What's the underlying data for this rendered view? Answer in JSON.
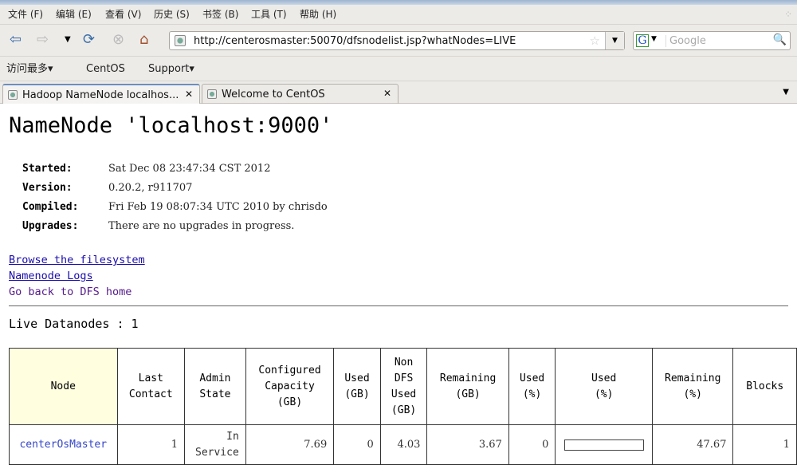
{
  "menu": [
    "文件 (F)",
    "编辑 (E)",
    "查看 (V)",
    "历史 (S)",
    "书签 (B)",
    "工具 (T)",
    "帮助 (H)"
  ],
  "url": "http://centerosmaster:50070/dfsnodelist.jsp?whatNodes=LIVE",
  "search_placeholder": "Google",
  "bookmarks": [
    "访问最多▾",
    "CentOS",
    "Support▾"
  ],
  "tabs": [
    {
      "label": "Hadoop NameNode localhos..."
    },
    {
      "label": "Welcome to CentOS"
    }
  ],
  "page": {
    "title": "NameNode 'localhost:9000'",
    "info": [
      {
        "k": "Started:",
        "v": "Sat Dec 08 23:47:34 CST 2012"
      },
      {
        "k": "Version:",
        "v": "0.20.2, r911707"
      },
      {
        "k": "Compiled:",
        "v": "Fri Feb 19 08:07:34 UTC 2010 by chrisdo"
      },
      {
        "k": "Upgrades:",
        "v": "There are no upgrades in progress."
      }
    ],
    "links": [
      "Browse the filesystem",
      "Namenode Logs",
      "Go back to DFS home"
    ],
    "live_heading": "Live Datanodes : 1"
  },
  "table": {
    "headers": [
      "Node",
      "Last\nContact",
      "Admin\nState",
      "Configured\nCapacity\n(GB)",
      "Used\n(GB)",
      "Non\nDFS\nUsed\n(GB)",
      "Remaining\n(GB)",
      "Used\n(%)",
      "Used\n(%)",
      "Remaining\n(%)",
      "Blocks"
    ],
    "rows": [
      {
        "node": "centerOsMaster",
        "last_contact": "1",
        "admin_state": "In\nService",
        "capacity": "7.69",
        "used": "0",
        "non_dfs": "4.03",
        "remaining": "3.67",
        "used_pct": "0",
        "used_bar_pct": 0,
        "remaining_pct": "47.67",
        "blocks": "1"
      }
    ]
  }
}
